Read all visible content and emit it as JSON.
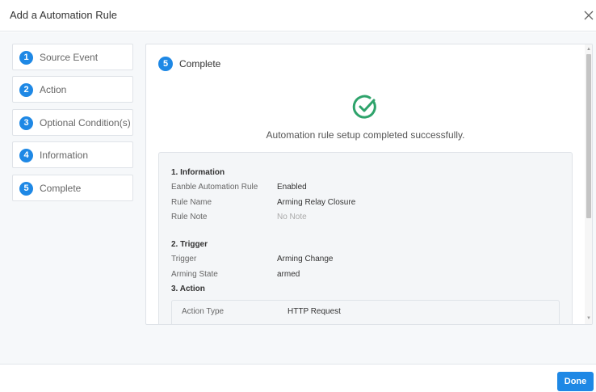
{
  "dialog": {
    "title": "Add a Automation Rule",
    "close_icon": "close-icon"
  },
  "steps": [
    {
      "number": "1",
      "label": "Source Event"
    },
    {
      "number": "2",
      "label": "Action"
    },
    {
      "number": "3",
      "label": "Optional Condition(s)"
    },
    {
      "number": "4",
      "label": "Information"
    },
    {
      "number": "5",
      "label": "Complete"
    }
  ],
  "panel": {
    "step_number": "5",
    "step_label": "Complete",
    "status_icon": "check-circle-icon",
    "success_message": "Automation rule setup completed successfully.",
    "summary": {
      "information": {
        "title": "1. Information",
        "rows": [
          {
            "key": "Eanble Automation Rule",
            "value": "Enabled"
          },
          {
            "key": "Rule Name",
            "value": "Arming Relay Closure"
          },
          {
            "key": "Rule Note",
            "value": "No Note"
          }
        ]
      },
      "trigger": {
        "title": "2. Trigger",
        "rows": [
          {
            "key": "Trigger",
            "value": "Arming Change"
          },
          {
            "key": "Arming State",
            "value": "armed"
          }
        ]
      },
      "action": {
        "title": "3. Action",
        "rows": [
          {
            "key": "Action Type",
            "value": "HTTP Request"
          }
        ]
      }
    }
  },
  "footer": {
    "done_label": "Done"
  },
  "colors": {
    "accent": "#1e88e5",
    "success": "#2ea36b",
    "background": "#f6f8fa"
  }
}
